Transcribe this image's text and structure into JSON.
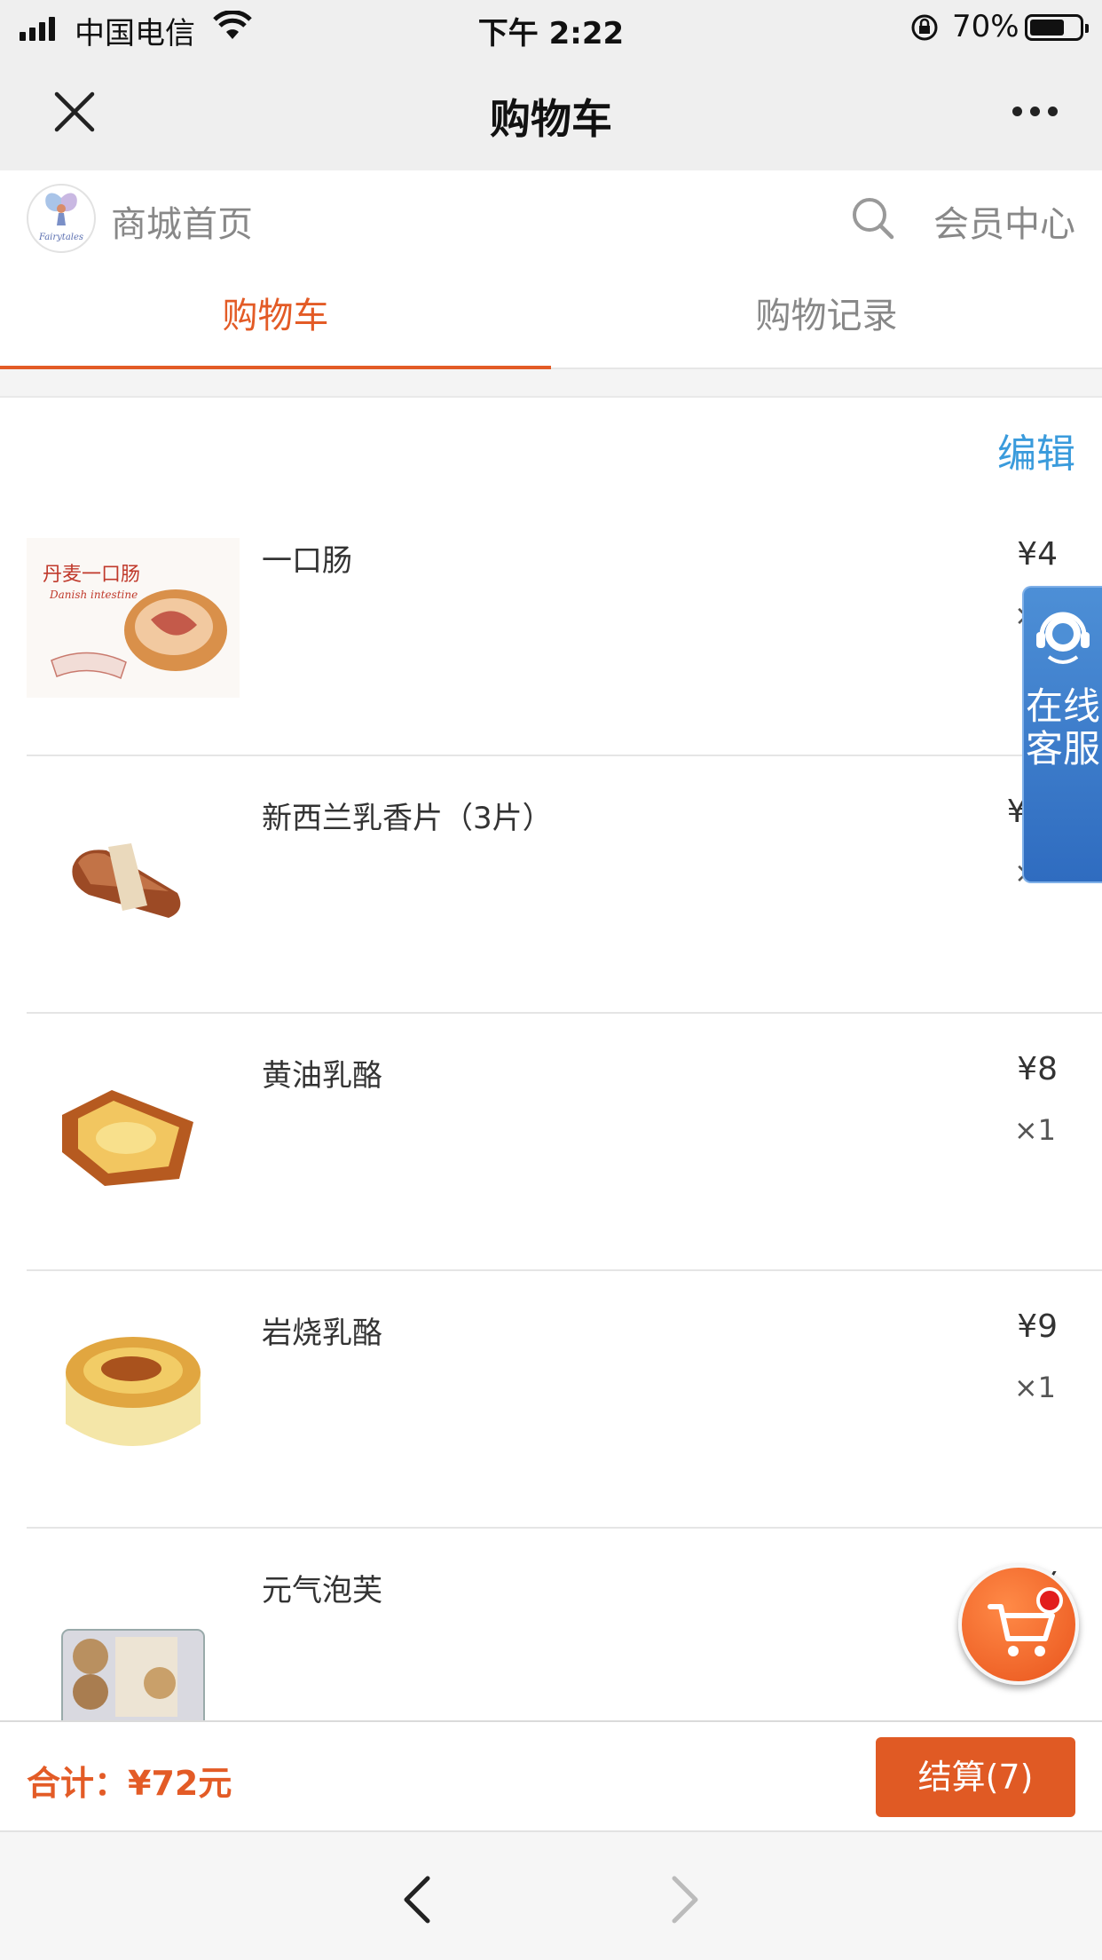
{
  "status_bar": {
    "carrier": "中国电信",
    "time": "下午 2:22",
    "battery_percent": "70%",
    "battery_level": 0.7,
    "signal_icon": "signal-bars-icon",
    "wifi_icon": "wifi-icon",
    "lock_icon": "rotation-lock-icon"
  },
  "title_bar": {
    "title": "购物车",
    "close_icon": "close-icon",
    "more_icon": "more-dots-icon"
  },
  "shop_header": {
    "logo_text": "Fairytales",
    "home_label": "商城首页",
    "member_label": "会员中心",
    "search_icon": "search-icon"
  },
  "tabs": [
    {
      "label": "购物车",
      "active": true
    },
    {
      "label": "购物记录",
      "active": false
    }
  ],
  "edit_label": "编辑",
  "items": [
    {
      "name": "一口肠",
      "price": "¥4",
      "qty": "×1",
      "image_text": "丹麦一口肠"
    },
    {
      "name": "新西兰乳香片（3片）",
      "price": "¥7.",
      "qty": "×1"
    },
    {
      "name": "黄油乳酪",
      "price": "¥8",
      "qty": "×1"
    },
    {
      "name": "岩烧乳酪",
      "price": "¥9",
      "qty": "×1"
    },
    {
      "name": "元气泡芙",
      "price": "¥",
      "qty": ""
    }
  ],
  "service": {
    "label": "在线客服",
    "icon": "headset-icon"
  },
  "float_cart": {
    "icon": "cart-icon"
  },
  "bottom_bar": {
    "total_label": "合计：¥72元",
    "checkout_label": "结算(7)"
  },
  "browser_nav": {
    "back_icon": "chevron-left-icon",
    "forward_icon": "chevron-right-icon"
  },
  "colors": {
    "accent": "#e35b26",
    "link_blue": "#3a9bdc",
    "service_blue": "#2f6cc0"
  }
}
